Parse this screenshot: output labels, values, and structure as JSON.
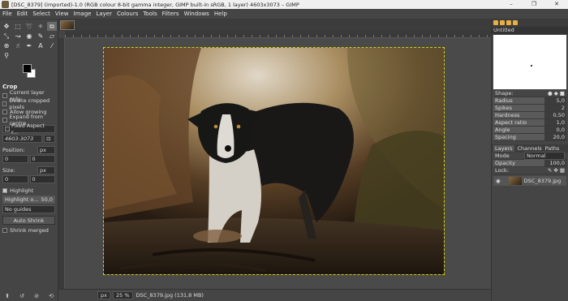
{
  "window": {
    "title": "[DSC_8379] (imported)-1.0 (RGB colour 8-bit gamma integer, GIMP built-in sRGB, 1 layer) 4603x3073 – GIMP",
    "minimize": "–",
    "maximize": "❐",
    "close": "✕"
  },
  "menu": [
    "File",
    "Edit",
    "Select",
    "View",
    "Image",
    "Layer",
    "Colours",
    "Tools",
    "Filters",
    "Windows",
    "Help"
  ],
  "tool_options": {
    "title": "Crop",
    "checks": [
      {
        "label": "Current layer only",
        "checked": false
      },
      {
        "label": "Delete cropped pixels",
        "checked": false
      },
      {
        "label": "Allow growing",
        "checked": false
      },
      {
        "label": "Expand from centre",
        "checked": false
      }
    ],
    "fixed_aspect": "Fixed Aspect r...",
    "ratio_value": "4603:3073",
    "position_label": "Position:",
    "position_unit": "px",
    "position_x": "0",
    "position_y": "0",
    "size_label": "Size:",
    "size_unit": "px",
    "size_w": "0",
    "size_h": "0",
    "highlight_label": "Highlight",
    "highlight_opacity_label": "Highlight o...",
    "highlight_opacity_value": "50,0",
    "guides_value": "No guides",
    "auto_shrink": "Auto Shrink",
    "shrink_merged": "Shrink merged"
  },
  "status": {
    "unit": "px",
    "zoom": "25 %",
    "file_info": "DSC_8379.jpg (131,8 MB)"
  },
  "brushes": {
    "name": "Untitled",
    "shape_label": "Shape:",
    "props": [
      {
        "label": "Radius",
        "value": "5,0"
      },
      {
        "label": "Spikes",
        "value": "2"
      },
      {
        "label": "Hardness",
        "value": "0,50"
      },
      {
        "label": "Aspect ratio",
        "value": "1,0"
      },
      {
        "label": "Angle",
        "value": "0,0"
      },
      {
        "label": "Spacing",
        "value": "20,0"
      }
    ]
  },
  "layers": {
    "tabs": [
      "Layers",
      "Channels",
      "Paths"
    ],
    "mode_label": "Mode",
    "mode_value": "Normal",
    "opacity_label": "Opacity",
    "opacity_value": "100,0",
    "lock_label": "Lock:",
    "layer_name": "DSC_8379.jpg"
  }
}
